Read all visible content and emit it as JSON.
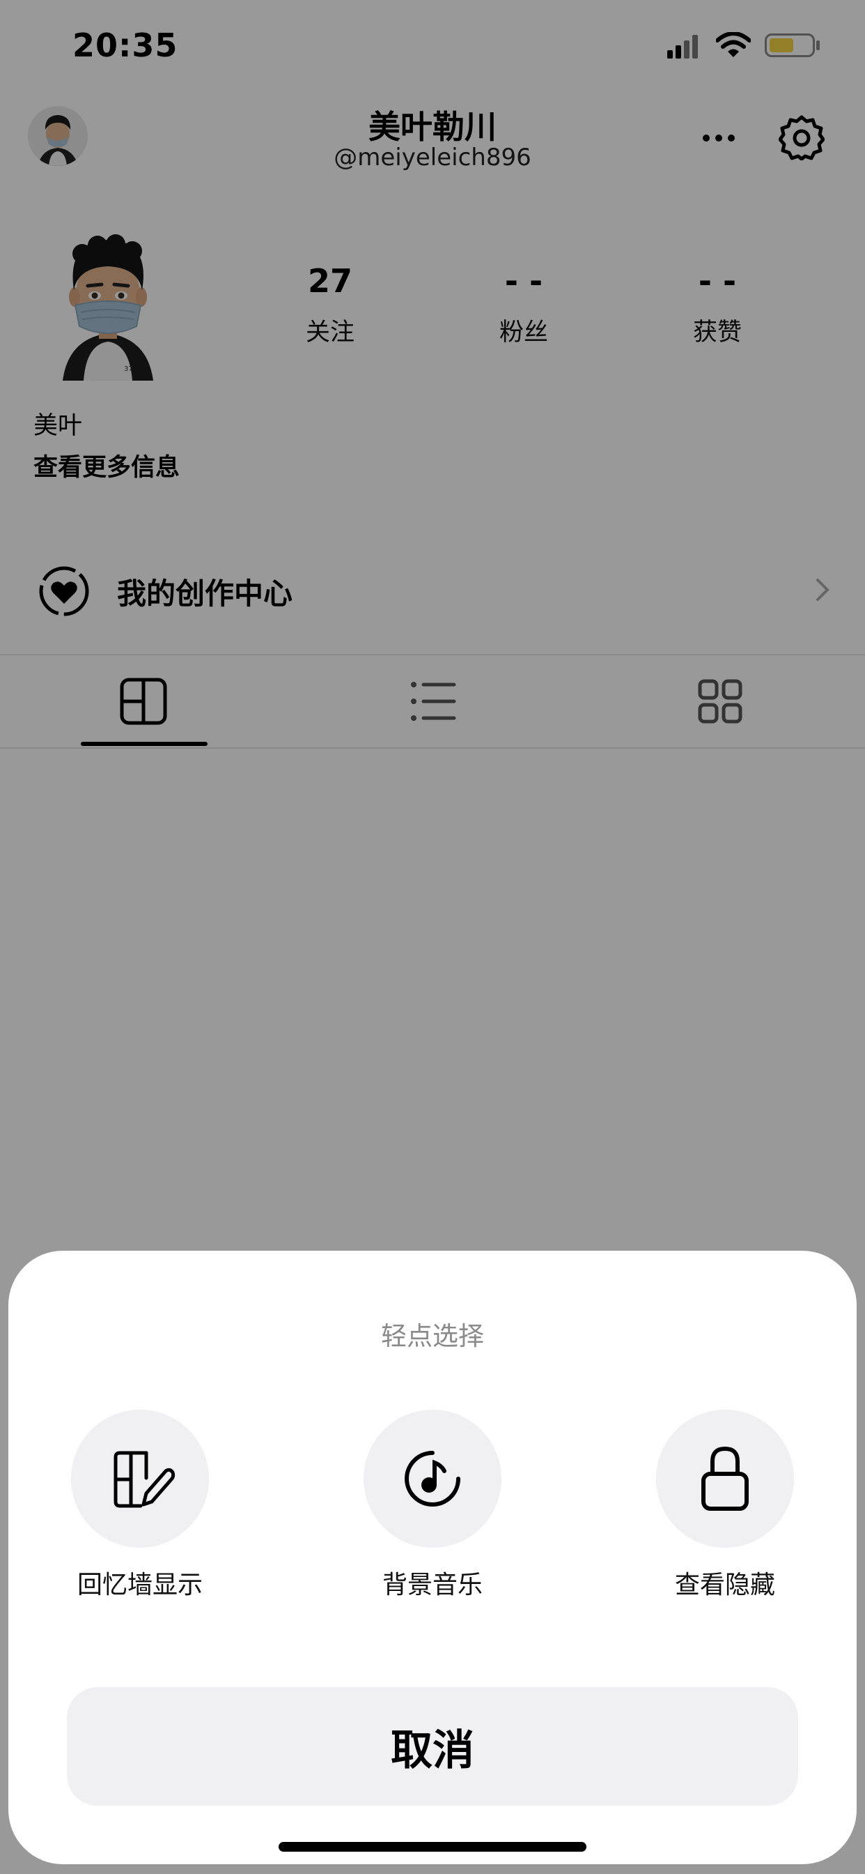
{
  "status_bar": {
    "time": "20:35"
  },
  "header": {
    "title": "美叶勒川",
    "handle": "@meiyeleich896"
  },
  "stats": [
    {
      "value": "27",
      "label": "关注"
    },
    {
      "value": "- -",
      "label": "粉丝"
    },
    {
      "value": "- -",
      "label": "获赞"
    }
  ],
  "profile": {
    "nickname": "美叶",
    "more_info": "查看更多信息"
  },
  "creator_center": {
    "label": "我的创作中心"
  },
  "sheet": {
    "title": "轻点选择",
    "options": [
      {
        "label": "回忆墙显示",
        "icon": "memory-wall-edit-icon"
      },
      {
        "label": "背景音乐",
        "icon": "music-note-icon"
      },
      {
        "label": "查看隐藏",
        "icon": "lock-icon"
      }
    ],
    "cancel": "取消"
  },
  "colors": {
    "battery": "#f5d442",
    "overlay": "rgba(0,0,0,0.40)"
  }
}
